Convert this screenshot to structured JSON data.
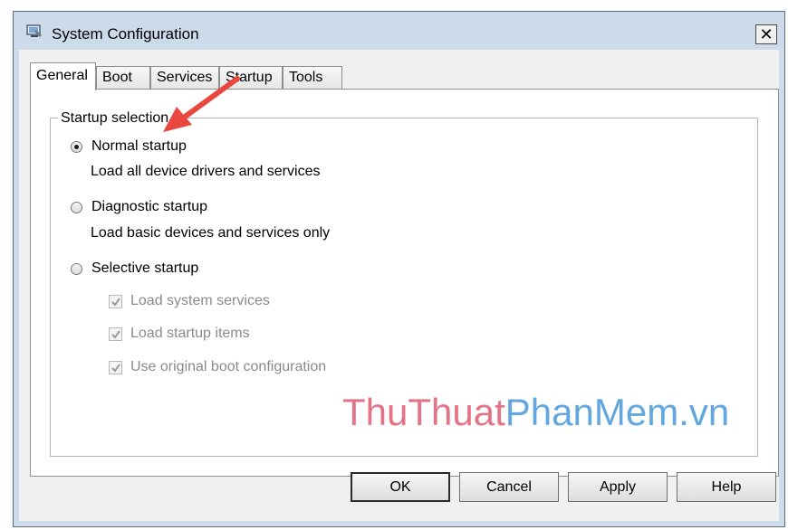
{
  "window": {
    "title": "System Configuration",
    "close_label": "✕"
  },
  "tabs": [
    {
      "label": "General",
      "active": true
    },
    {
      "label": "Boot",
      "active": false
    },
    {
      "label": "Services",
      "active": false
    },
    {
      "label": "Startup",
      "active": false
    },
    {
      "label": "Tools",
      "active": false
    }
  ],
  "startup_selection": {
    "legend": "Startup selection",
    "normal": {
      "label": "Normal startup",
      "description": "Load all device drivers and services",
      "selected": true
    },
    "diagnostic": {
      "label": "Diagnostic startup",
      "description": "Load basic devices and services only",
      "selected": false
    },
    "selective": {
      "label": "Selective startup",
      "selected": false,
      "options": [
        {
          "label": "Load system services",
          "checked": true,
          "enabled": false
        },
        {
          "label": "Load startup items",
          "checked": true,
          "enabled": false
        },
        {
          "label": "Use original boot configuration",
          "checked": true,
          "enabled": false
        }
      ]
    }
  },
  "watermark": {
    "part1": "ThuThuat",
    "part2": "PhanMem.vn"
  },
  "buttons": {
    "ok": "OK",
    "cancel": "Cancel",
    "apply": "Apply",
    "help": "Help"
  },
  "colors": {
    "annotation_arrow": "#e8483f",
    "watermark_pink": "#e57387",
    "watermark_blue": "#62a7e0"
  }
}
